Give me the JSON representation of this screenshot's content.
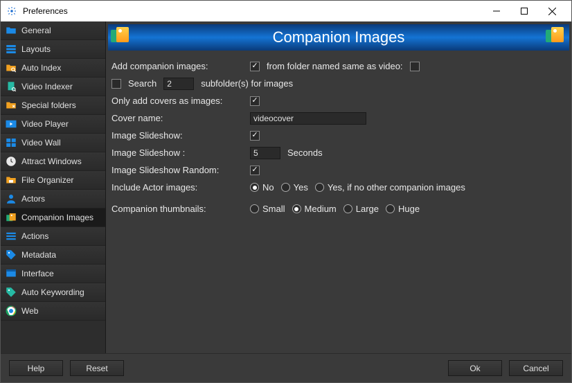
{
  "window": {
    "title": "Preferences"
  },
  "sidebar": {
    "items": [
      {
        "label": "General",
        "icon": "folder-blue"
      },
      {
        "label": "Layouts",
        "icon": "layouts"
      },
      {
        "label": "Auto Index",
        "icon": "auto-index"
      },
      {
        "label": "Video Indexer",
        "icon": "indexer"
      },
      {
        "label": "Special folders",
        "icon": "special-folders"
      },
      {
        "label": "Video Player",
        "icon": "player"
      },
      {
        "label": "Video Wall",
        "icon": "wall"
      },
      {
        "label": "Attract Windows",
        "icon": "clock"
      },
      {
        "label": "File Organizer",
        "icon": "organizer"
      },
      {
        "label": "Actors",
        "icon": "actor"
      },
      {
        "label": "Companion Images",
        "icon": "companion",
        "active": true
      },
      {
        "label": "Actions",
        "icon": "actions"
      },
      {
        "label": "Metadata",
        "icon": "tag"
      },
      {
        "label": "Interface",
        "icon": "interface"
      },
      {
        "label": "Auto Keywording",
        "icon": "keywording"
      },
      {
        "label": "Web",
        "icon": "web"
      }
    ]
  },
  "banner": {
    "title": "Companion Images"
  },
  "form": {
    "add_companion_label": "Add companion images:",
    "add_companion_checked": true,
    "from_folder_label": "from folder named same as video:",
    "from_folder_checked": false,
    "search_label": "Search",
    "search_checked": false,
    "search_count": "2",
    "search_suffix": "subfolder(s) for images",
    "only_covers_label": "Only add covers as images:",
    "only_covers_checked": true,
    "cover_name_label": "Cover name:",
    "cover_name_value": "videocover",
    "slideshow_label": "Image Slideshow:",
    "slideshow_checked": true,
    "slideshow_interval_label": "Image Slideshow :",
    "slideshow_interval_value": "5",
    "slideshow_interval_unit": "Seconds",
    "slideshow_random_label": "Image Slideshow Random:",
    "slideshow_random_checked": true,
    "include_actor_label": "Include Actor images:",
    "include_actor_options": [
      "No",
      "Yes",
      "Yes, if no other companion images"
    ],
    "include_actor_selected": 0,
    "thumbnails_label": "Companion thumbnails:",
    "thumbnails_options": [
      "Small",
      "Medium",
      "Large",
      "Huge"
    ],
    "thumbnails_selected": 1
  },
  "footer": {
    "help": "Help",
    "reset": "Reset",
    "ok": "Ok",
    "cancel": "Cancel"
  }
}
